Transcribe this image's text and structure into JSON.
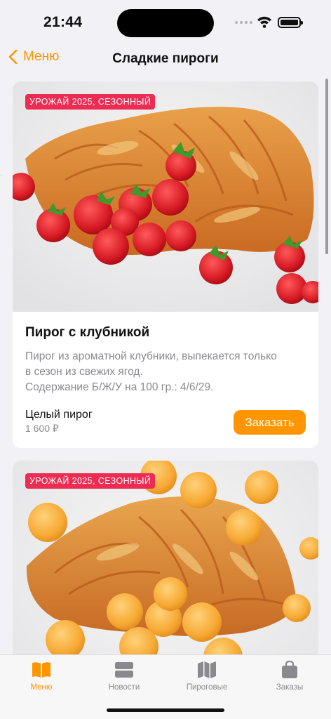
{
  "status_bar": {
    "time": "21:44"
  },
  "nav": {
    "back_label": "Меню",
    "title": "Сладкие пироги"
  },
  "products": [
    {
      "badge": "УРОЖАЙ 2025, СЕЗОННЫЙ",
      "title": "Пирог с клубникой",
      "description_lines": [
        "Пирог из ароматной клубники, выпекается только",
        "в сезон из свежих ягод.",
        "Содержание Б/Ж/У на 100 гр.: 4/6/29."
      ],
      "variant": "Целый пирог",
      "price": "1 600 ₽",
      "order_label": "Заказать",
      "image": "strawberry-pie-photo"
    },
    {
      "badge": "УРОЖАЙ 2025, СЕЗОННЫЙ",
      "image": "apricot-pie-photo"
    }
  ],
  "tabs": [
    {
      "label": "Меню",
      "icon": "book-icon",
      "active": true
    },
    {
      "label": "Новости",
      "icon": "news-icon",
      "active": false
    },
    {
      "label": "Пироговые",
      "icon": "map-icon",
      "active": false
    },
    {
      "label": "Заказы",
      "icon": "bag-icon",
      "active": false
    }
  ],
  "colors": {
    "accent": "#ff9500",
    "badge": "#ee2b52",
    "background": "#f2f2f6"
  }
}
